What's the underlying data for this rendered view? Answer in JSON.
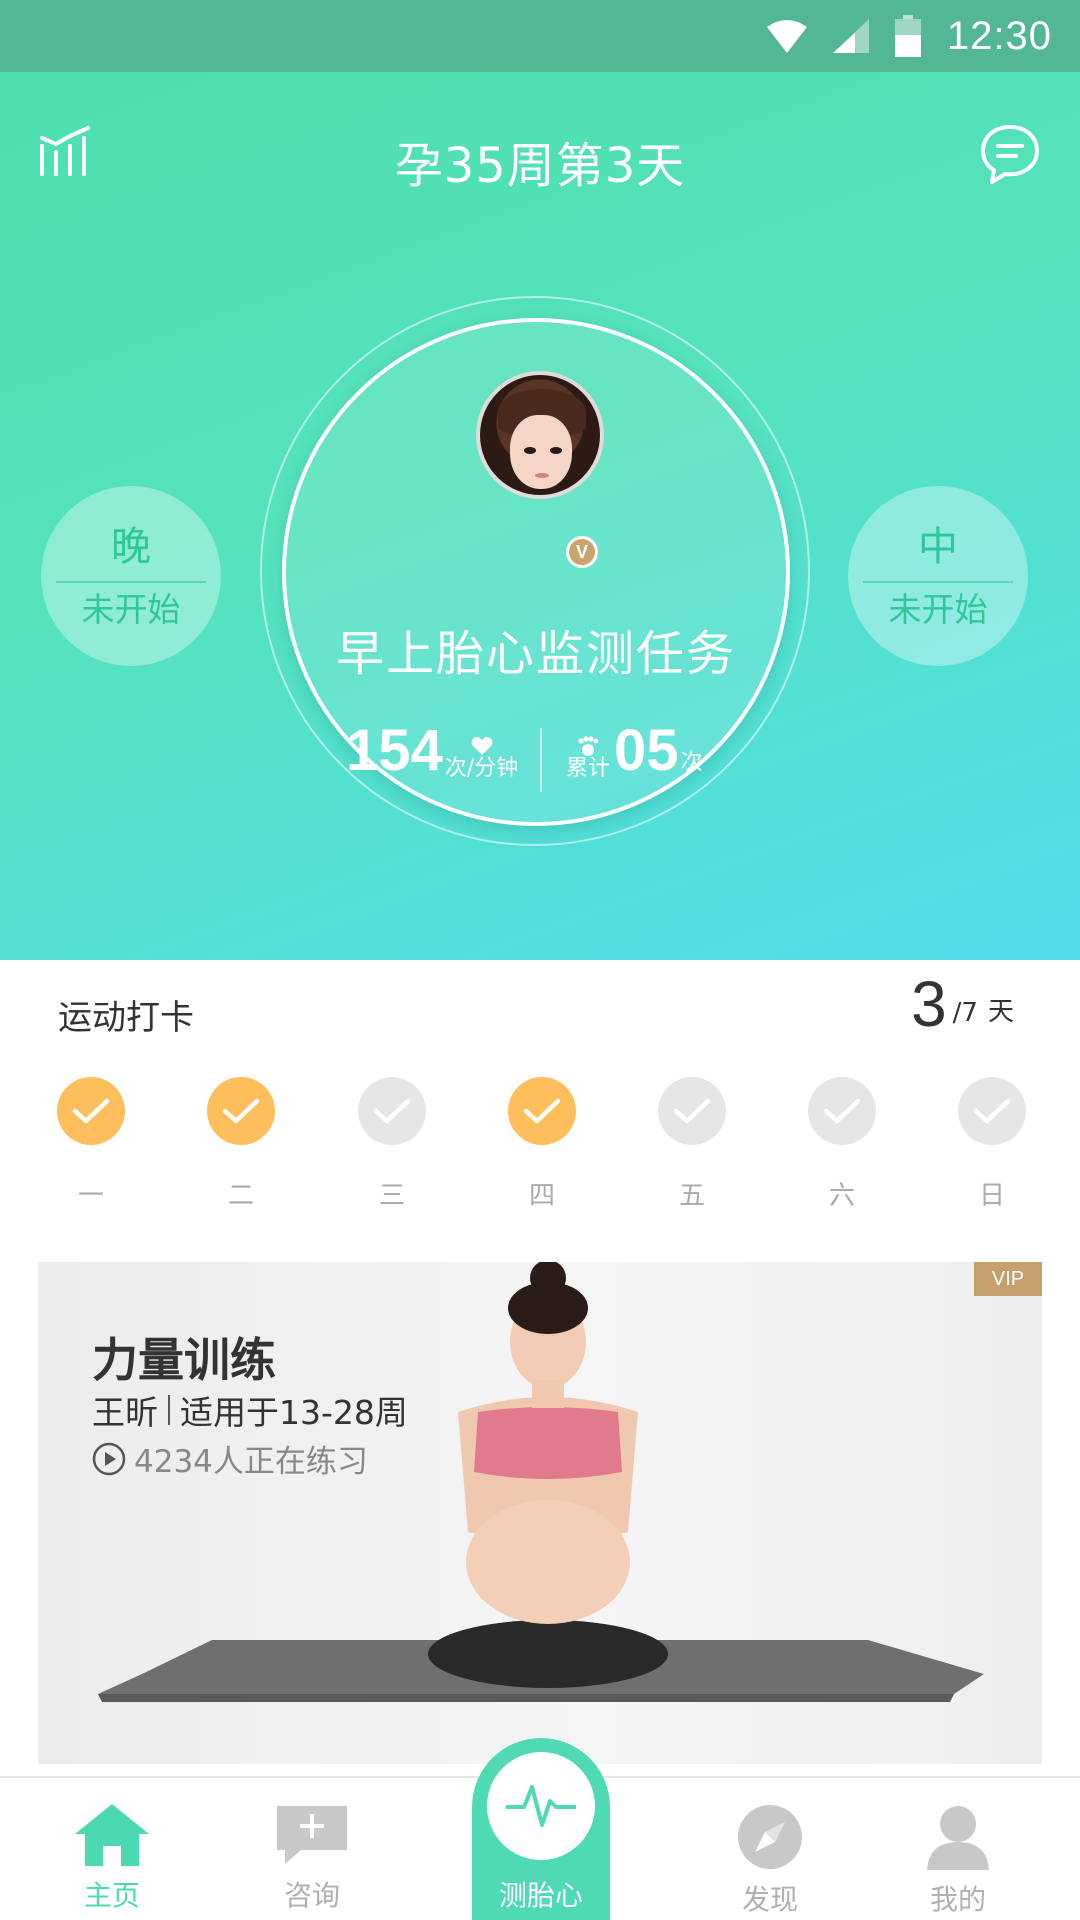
{
  "status_bar": {
    "time": "12:30",
    "icons": [
      "wifi-icon",
      "signal-icon",
      "battery-icon"
    ]
  },
  "header": {
    "title": "孕35周第3天",
    "left_icon": "chart-icon",
    "right_icon": "message-icon"
  },
  "monitor": {
    "task_title": "早上胎心监测任务",
    "heart_rate": "154",
    "heart_rate_unit": "次/分钟",
    "cumulative_label": "累计",
    "cumulative_count": "05",
    "cumulative_unit": "次",
    "avatar_badge": "V",
    "sessions": [
      {
        "period": "晚",
        "status": "未开始"
      },
      {
        "period": "中",
        "status": "未开始"
      }
    ]
  },
  "checkin": {
    "title": "运动打卡",
    "done_count": "3",
    "total": "/7",
    "unit": "天",
    "days": [
      {
        "label": "一",
        "done": true
      },
      {
        "label": "二",
        "done": true
      },
      {
        "label": "三",
        "done": false
      },
      {
        "label": "四",
        "done": true
      },
      {
        "label": "五",
        "done": false
      },
      {
        "label": "六",
        "done": false
      },
      {
        "label": "日",
        "done": false
      }
    ]
  },
  "course": {
    "badge": "VIP",
    "title": "力量训练",
    "coach": "王昕",
    "suitable": "适用于13-28周",
    "learners": "4234人正在练习"
  },
  "nav": {
    "items": [
      {
        "label": "主页",
        "icon": "home-icon",
        "active": true
      },
      {
        "label": "咨询",
        "icon": "chat-add-icon",
        "active": false
      },
      {
        "label": "测胎心",
        "icon": "heartbeat-icon",
        "active": false
      },
      {
        "label": "发现",
        "icon": "compass-icon",
        "active": false
      },
      {
        "label": "我的",
        "icon": "user-icon",
        "active": false
      }
    ]
  },
  "colors": {
    "accent": "#4cd9b1",
    "checked": "#fdbe5b",
    "unchecked": "#e6e6e6",
    "vip": "#c6a06a"
  }
}
